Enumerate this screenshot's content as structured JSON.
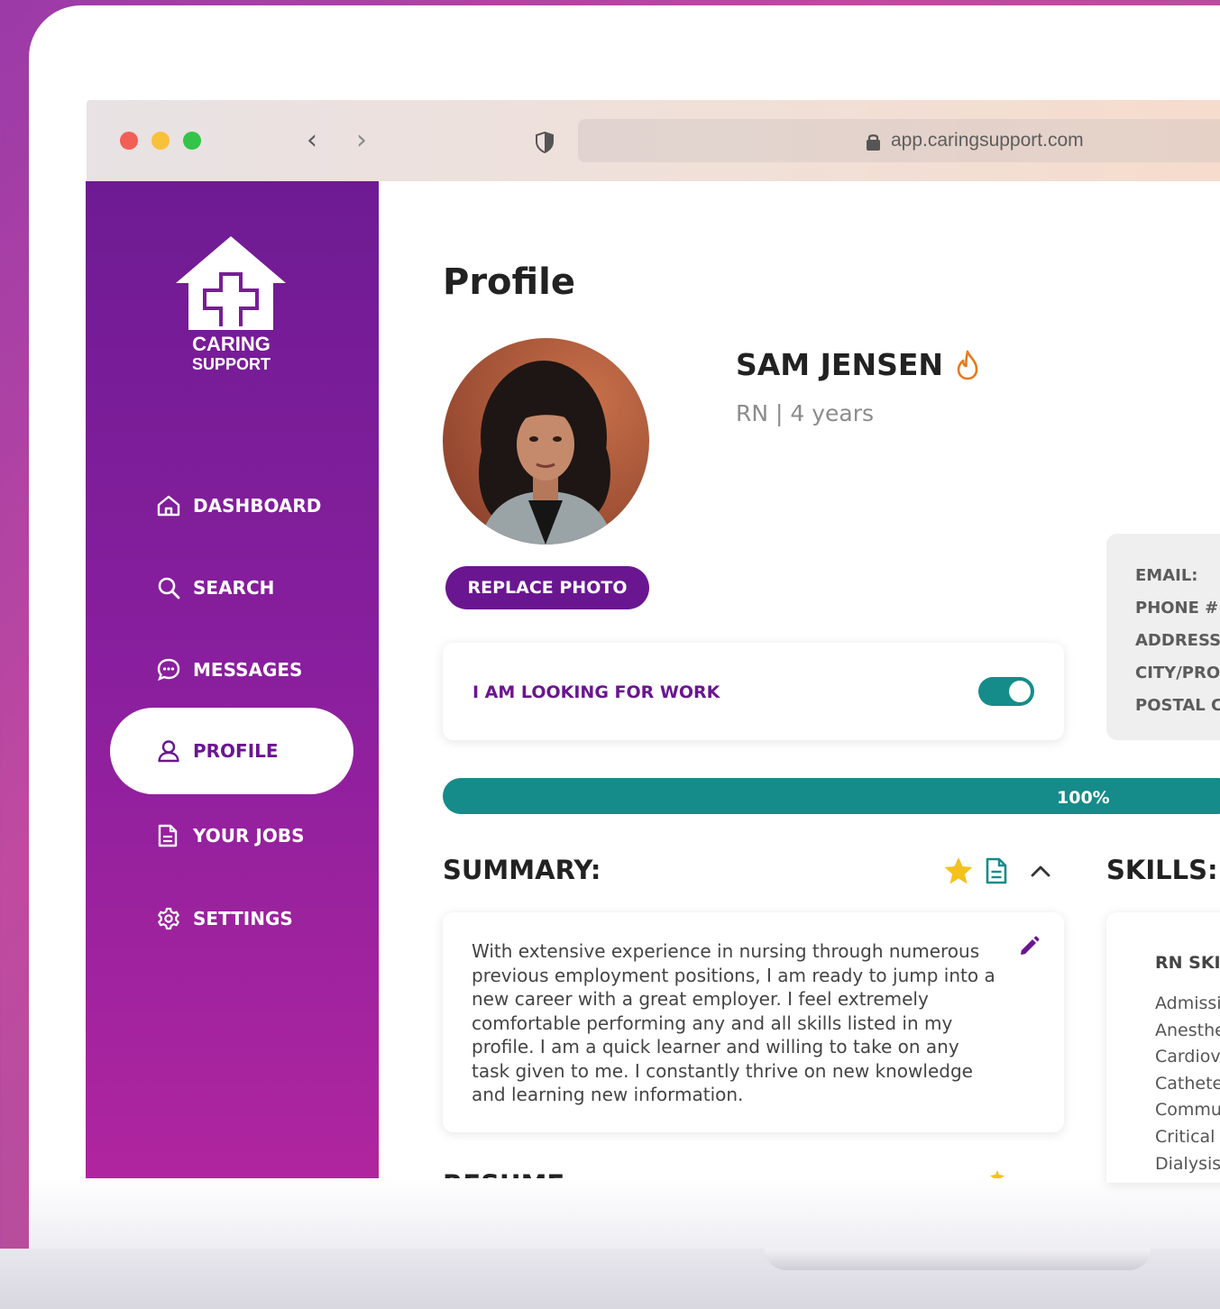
{
  "browser": {
    "url": "app.caringsupport.com",
    "traffic_lights": [
      "#f15f57",
      "#f8c13a",
      "#33c449"
    ]
  },
  "brand": {
    "line1": "CARING",
    "line2": "SUPPORT",
    "sidebar_color": "#7a1c98",
    "accent_teal": "#158c8a"
  },
  "sidebar": {
    "items": [
      {
        "label": "DASHBOARD",
        "icon": "home-icon"
      },
      {
        "label": "SEARCH",
        "icon": "search-icon"
      },
      {
        "label": "MESSAGES",
        "icon": "chat-icon"
      },
      {
        "label": "PROFILE",
        "icon": "user-icon",
        "active": true
      },
      {
        "label": "YOUR JOBS",
        "icon": "document-icon"
      },
      {
        "label": "SETTINGS",
        "icon": "gear-icon"
      }
    ]
  },
  "page": {
    "title": "Profile"
  },
  "profile": {
    "name": "SAM JENSEN",
    "subtitle": "RN | 4 years",
    "replace_photo_label": "REPLACE PHOTO",
    "looking_for_work_label": "I AM LOOKING FOR WORK",
    "looking_for_work": true
  },
  "contact": {
    "labels": [
      "EMAIL:",
      "PHONE #:",
      "ADDRESS:",
      "CITY/PRO",
      "POSTAL C"
    ]
  },
  "progress": {
    "label": "100%",
    "value": 1.0
  },
  "summary": {
    "title": "SUMMARY:",
    "text": "With extensive experience in nursing through numerous previous employment positions, I am ready to jump into a new career with a great employer. I feel extremely comfortable performing any and all skills listed in my profile. I am a quick learner and willing to take on any task given to me. I constantly thrive on new knowledge and learning new information."
  },
  "skills": {
    "title": "SKILLS:",
    "heading": "RN SKI",
    "items": [
      "Admissi",
      "Anesthe",
      "Cardiov",
      "Cathete",
      "Commu",
      "Critical",
      "Dialysis"
    ]
  },
  "resume": {
    "title": "RESUME"
  }
}
